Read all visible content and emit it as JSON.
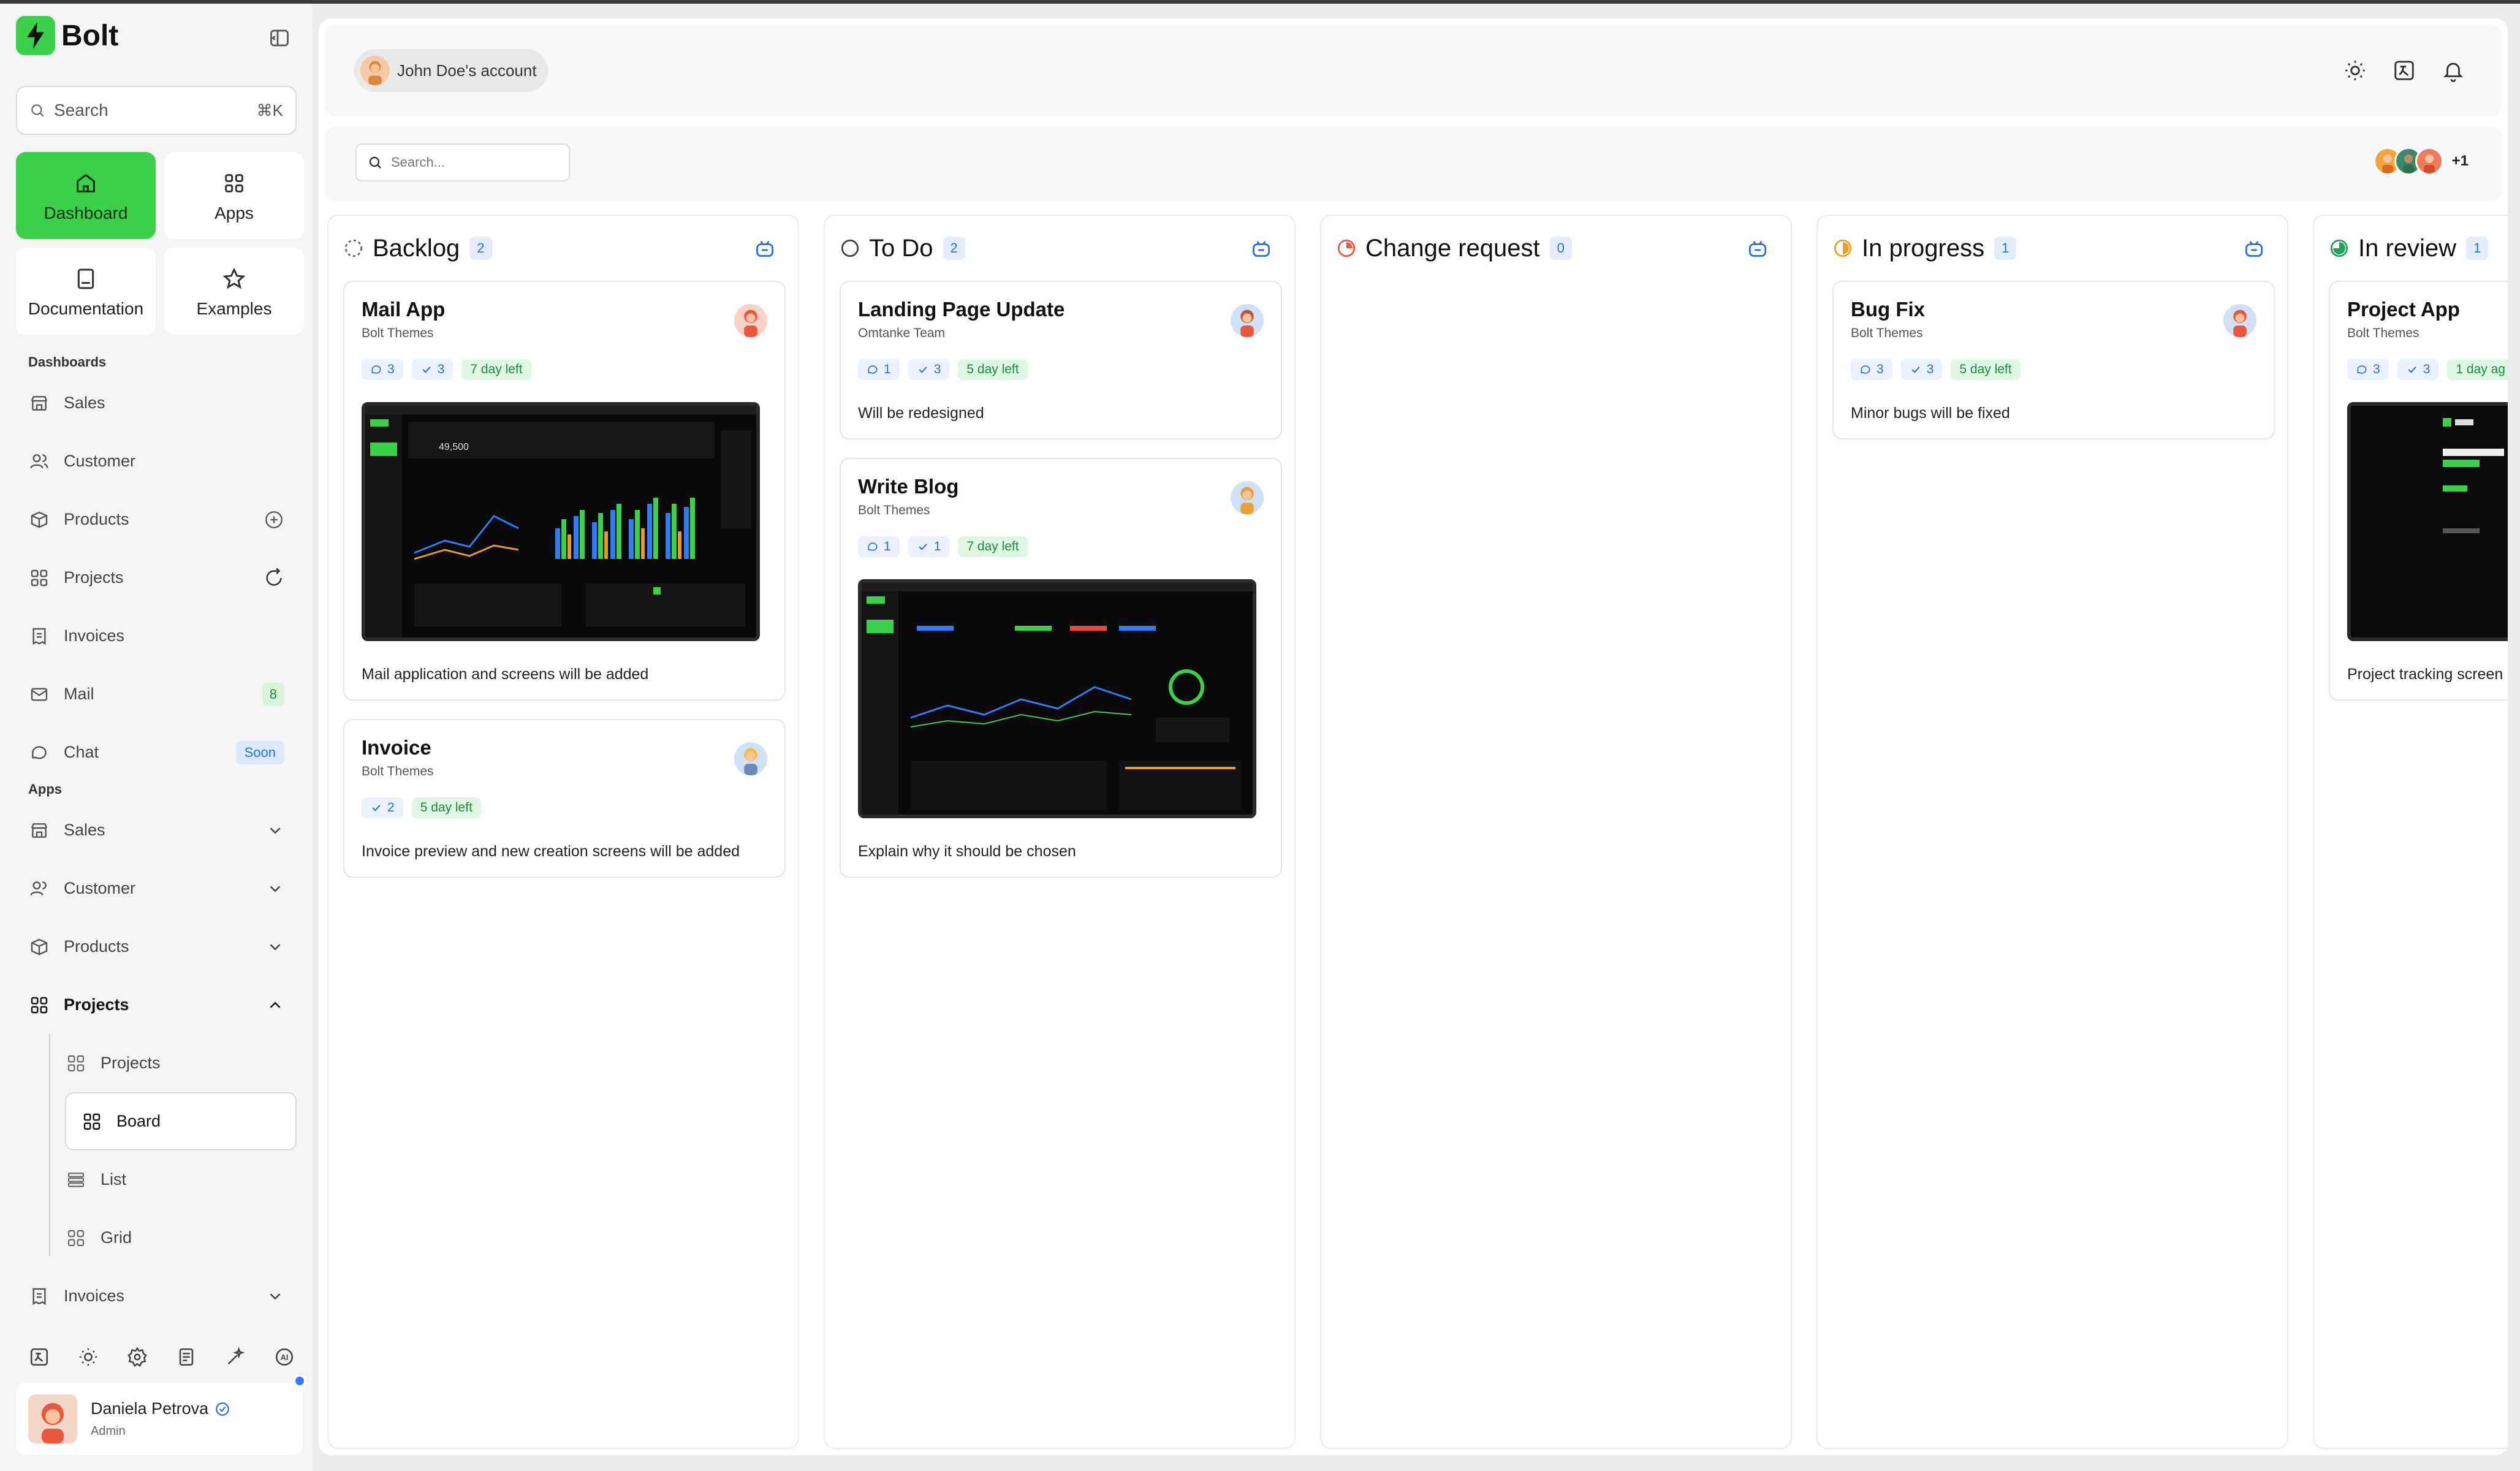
{
  "app": {
    "name": "Bolt"
  },
  "sidebar": {
    "search_label": "Search",
    "search_shortcut": "⌘K",
    "quick": [
      {
        "label": "Dashboard",
        "icon": "home-icon"
      },
      {
        "label": "Apps",
        "icon": "grid-icon"
      },
      {
        "label": "Documentation",
        "icon": "book-icon"
      },
      {
        "label": "Examples",
        "icon": "star-icon"
      }
    ],
    "dashboards_label": "Dashboards",
    "dashboards": [
      {
        "label": "Sales"
      },
      {
        "label": "Customer"
      },
      {
        "label": "Products"
      },
      {
        "label": "Projects"
      },
      {
        "label": "Invoices"
      },
      {
        "label": "Mail",
        "badge": "8"
      },
      {
        "label": "Chat",
        "badge": "Soon"
      }
    ],
    "apps_label": "Apps",
    "apps": [
      {
        "label": "Sales"
      },
      {
        "label": "Customer"
      },
      {
        "label": "Products"
      },
      {
        "label": "Projects"
      }
    ],
    "projects_sub": [
      {
        "label": "Projects"
      },
      {
        "label": "Board"
      },
      {
        "label": "List"
      },
      {
        "label": "Grid"
      }
    ],
    "invoices_label": "Invoices",
    "user": {
      "name": "Daniela Petrova",
      "role": "Admin"
    }
  },
  "header": {
    "account": "John Doe's account"
  },
  "board": {
    "search_placeholder": "Search...",
    "members_more": "+1",
    "columns": [
      {
        "title": "Backlog",
        "count": "2",
        "cards": [
          {
            "title": "Mail App",
            "sub": "Bolt Themes",
            "comments": "3",
            "checks": "3",
            "due": "7 day left",
            "desc": "Mail application and screens will be added"
          },
          {
            "title": "Invoice",
            "sub": "Bolt Themes",
            "checks": "2",
            "due": "5 day left",
            "desc": "Invoice preview and new creation screens will be added"
          }
        ]
      },
      {
        "title": "To Do",
        "count": "2",
        "cards": [
          {
            "title": "Landing Page Update",
            "sub": "Omtanke Team",
            "comments": "1",
            "checks": "3",
            "due": "5 day left",
            "desc": "Will be redesigned"
          },
          {
            "title": "Write Blog",
            "sub": "Bolt Themes",
            "comments": "1",
            "checks": "1",
            "due": "7 day left",
            "desc": "Explain why it should be chosen"
          }
        ]
      },
      {
        "title": "Change request",
        "count": "0",
        "cards": []
      },
      {
        "title": "In progress",
        "count": "1",
        "cards": [
          {
            "title": "Bug Fix",
            "sub": "Bolt Themes",
            "comments": "3",
            "checks": "3",
            "due": "5 day left",
            "desc": "Minor bugs will be fixed"
          }
        ]
      },
      {
        "title": "In review",
        "count": "1",
        "cards": [
          {
            "title": "Project App",
            "sub": "Bolt Themes",
            "comments": "3",
            "checks": "3",
            "due": "1 day ag",
            "desc": "Project tracking screen"
          }
        ]
      }
    ]
  },
  "colors": {
    "accent": "#3ad04a",
    "blue": "#2a6fdb"
  }
}
